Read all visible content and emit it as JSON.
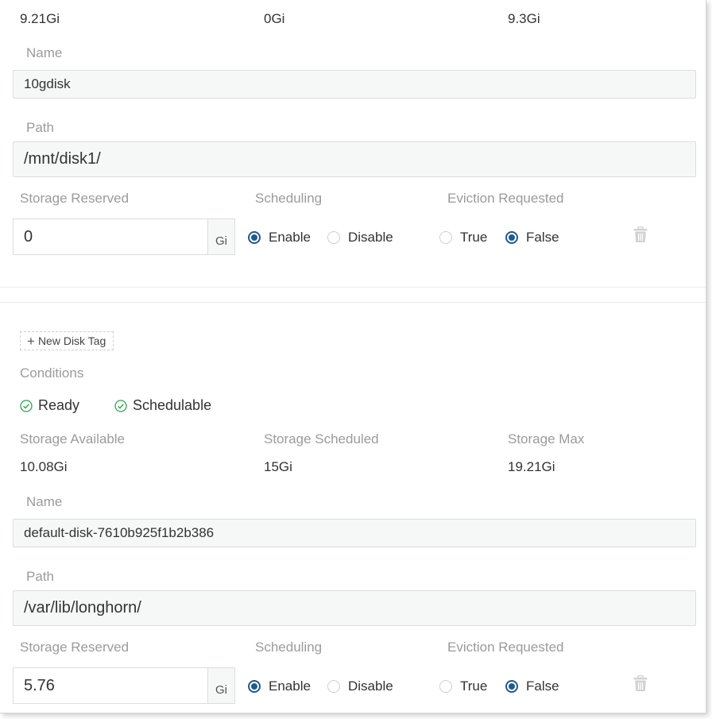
{
  "disk1": {
    "storage": {
      "available": "9.21Gi",
      "scheduled": "0Gi",
      "max": "9.3Gi"
    },
    "name_label": "Name",
    "name_value": "10gdisk",
    "path_label": "Path",
    "path_value": "/mnt/disk1/",
    "reserved_label": "Storage Reserved",
    "reserved_value": "0",
    "reserved_unit": "Gi",
    "scheduling_label": "Scheduling",
    "scheduling_options": [
      "Enable",
      "Disable"
    ],
    "scheduling_selected": "Enable",
    "eviction_label": "Eviction Requested",
    "eviction_options": [
      "True",
      "False"
    ],
    "eviction_selected": "False"
  },
  "disk2": {
    "new_tag_label": "New Disk Tag",
    "conditions_label": "Conditions",
    "conditions": [
      "Ready",
      "Schedulable"
    ],
    "storage_available_label": "Storage Available",
    "storage_scheduled_label": "Storage Scheduled",
    "storage_max_label": "Storage Max",
    "storage": {
      "available": "10.08Gi",
      "scheduled": "15Gi",
      "max": "19.21Gi"
    },
    "name_label": "Name",
    "name_value": "default-disk-7610b925f1b2b386",
    "path_label": "Path",
    "path_value": "/var/lib/longhorn/",
    "reserved_label": "Storage Reserved",
    "reserved_value": "5.76",
    "reserved_unit": "Gi",
    "scheduling_label": "Scheduling",
    "scheduling_options": [
      "Enable",
      "Disable"
    ],
    "scheduling_selected": "Enable",
    "eviction_label": "Eviction Requested",
    "eviction_options": [
      "True",
      "False"
    ],
    "eviction_selected": "False"
  },
  "colors": {
    "radio_selected": "#1f5a8e",
    "condition_ok": "#2ea44f",
    "label_gray": "#9b9b9b",
    "field_bg": "#f6f8f8"
  },
  "icons": {
    "delete": "trash-icon",
    "add": "plus-icon",
    "condition": "check-circle-icon"
  }
}
